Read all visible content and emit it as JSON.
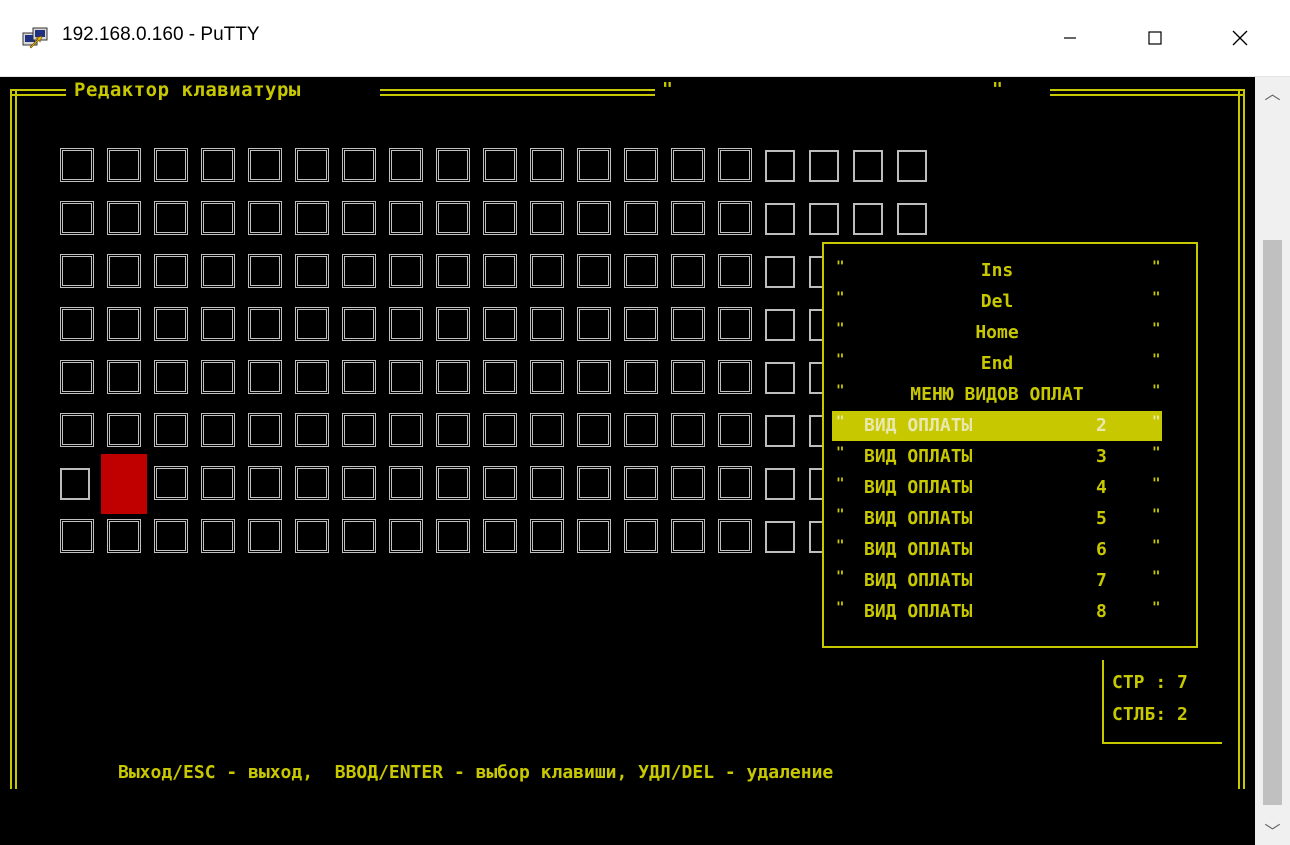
{
  "window": {
    "title": "192.168.0.160 - PuTTY",
    "app_icon": "putty-icon",
    "controls": {
      "minimize": "minimize-icon",
      "maximize": "maximize-icon",
      "close": "close-icon"
    }
  },
  "terminal": {
    "frame_title": "Редактор клавиатуры",
    "quote_mark": "\"",
    "keyboard": {
      "rows": 8,
      "selected_row": 7,
      "selected_col": 2
    },
    "menu": {
      "items": [
        {
          "label": "Ins",
          "num": ""
        },
        {
          "label": "Del",
          "num": ""
        },
        {
          "label": "Home",
          "num": ""
        },
        {
          "label": "End",
          "num": ""
        },
        {
          "label": "МЕНЮ ВИДОВ ОПЛАТ",
          "num": ""
        },
        {
          "label": "ВИД ОПЛАТЫ",
          "num": "2"
        },
        {
          "label": "ВИД ОПЛАТЫ",
          "num": "3"
        },
        {
          "label": "ВИД ОПЛАТЫ",
          "num": "4"
        },
        {
          "label": "ВИД ОПЛАТЫ",
          "num": "5"
        },
        {
          "label": "ВИД ОПЛАТЫ",
          "num": "6"
        },
        {
          "label": "ВИД ОПЛАТЫ",
          "num": "7"
        },
        {
          "label": "ВИД ОПЛАТЫ",
          "num": "8"
        }
      ],
      "active_index": 5
    },
    "status": {
      "row_line": "СТР : 7",
      "col_line": "СТЛБ: 2"
    },
    "hint": "Выход/ESC - выход,  ВВОД/ENTER - выбор клавиши, УДЛ/DEL - удаление"
  },
  "colors": {
    "text": "#c8c800",
    "selected_key": "#c00000",
    "key_border": "#c0c0c0",
    "background": "#000000"
  }
}
